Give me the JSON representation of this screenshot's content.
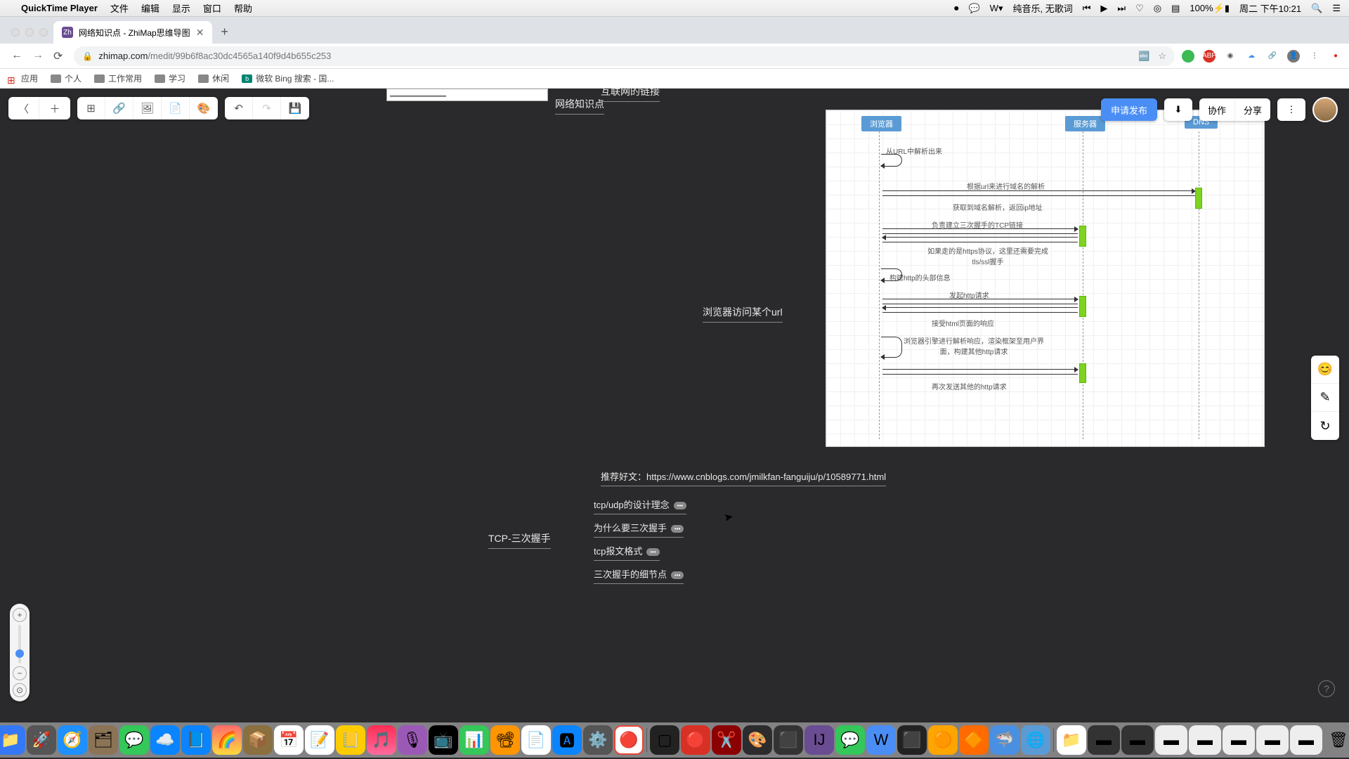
{
  "menubar": {
    "app": "QuickTime Player",
    "items": [
      "文件",
      "编辑",
      "显示",
      "窗口",
      "帮助"
    ],
    "music": "纯音乐, 无歌词",
    "battery": "100%",
    "clock": "周二 下午10:21"
  },
  "browser": {
    "tab_title": "网络知识点 - ZhiMap思维导图",
    "url_domain": "zhimap.com",
    "url_path": "/medit/99b6f8ac30dc4565a140f9d4b655c253",
    "bookmarks": [
      "应用",
      "个人",
      "工作常用",
      "学习",
      "休闲",
      "微软 Bing 搜索 - 国..."
    ]
  },
  "app_buttons": {
    "publish": "申请发布",
    "collab": "协作",
    "share": "分享"
  },
  "mindmap": {
    "root": "网络知识点",
    "internet_link": "互联网的链接",
    "browser_url": "浏览器访问某个url",
    "tcp_handshake": "TCP-三次握手",
    "article": "推荐好文：https://www.cnblogs.com/jmilkfan-fanguiju/p/10589771.html",
    "subs": [
      "tcp/udp的设计理念",
      "为什么要三次握手",
      "tcp报文格式",
      "三次握手的细节点"
    ]
  },
  "sequence": {
    "actors": [
      "浏览器",
      "服务器",
      "DNS"
    ],
    "steps": [
      "从URL中解析出来",
      "根据url来进行域名的解析",
      "获取到域名解析，返回ip地址",
      "负责建立三次握手的TCP链接",
      "如果走的是https协议，这里还需要完成tls/ssl握手",
      "构建http的头部信息",
      "发起http请求",
      "接受html页面的响应",
      "浏览器引擎进行解析响应，渲染框架至用户界面，构建其他http请求",
      "再次发送其他的http请求"
    ]
  }
}
